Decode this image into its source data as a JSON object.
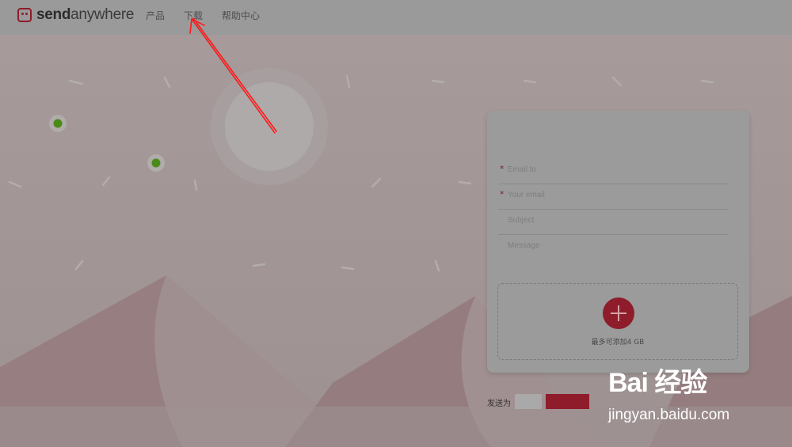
{
  "header": {
    "logo_bold": "send",
    "logo_light": "anywhere",
    "nav": [
      {
        "label": "产品"
      },
      {
        "label": "下载"
      },
      {
        "label": "帮助中心"
      }
    ]
  },
  "form": {
    "fields": [
      {
        "placeholder": "Email to",
        "required": "*"
      },
      {
        "placeholder": "Your email",
        "required": "*"
      },
      {
        "placeholder": "Subject",
        "required": ""
      },
      {
        "placeholder": "Message",
        "required": ""
      }
    ],
    "drop_text": "最多可添加4 GB"
  },
  "send": {
    "label": "发送为"
  },
  "watermark": {
    "logo_text": "Bai 经验",
    "url": "jingyan.baidu.com"
  },
  "colors": {
    "accent": "#8e1c2b",
    "annotation": "#ff1a1a"
  }
}
